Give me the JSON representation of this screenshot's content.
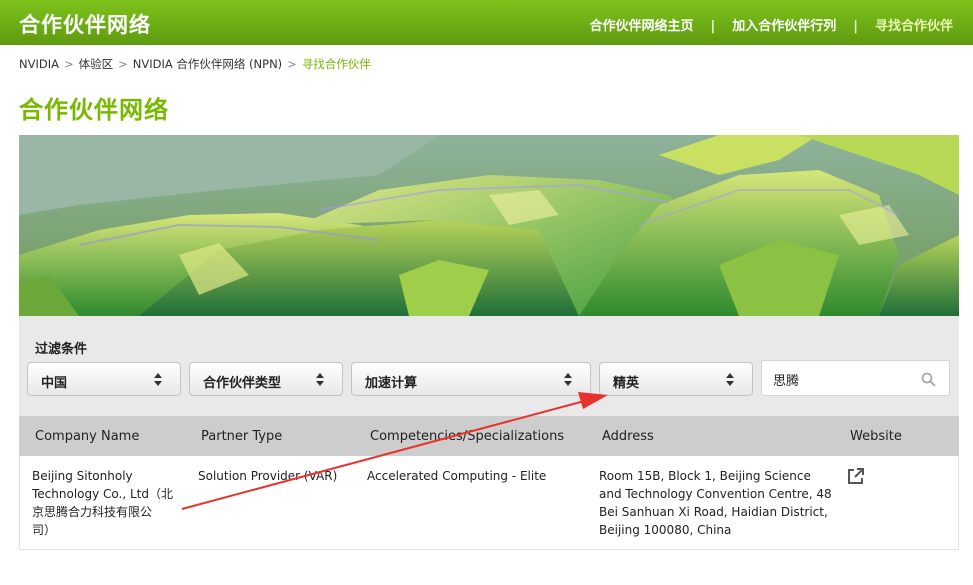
{
  "header": {
    "brand": "合作伙伴网络",
    "nav": [
      {
        "label": "合作伙伴网络主页"
      },
      {
        "label": "加入合作伙伴行列"
      },
      {
        "label": "寻找合作伙伴"
      }
    ],
    "separator": "|"
  },
  "breadcrumb": {
    "items": [
      "NVIDIA",
      "体验区",
      "NVIDIA 合作伙伴网络 (NPN)",
      "寻找合作伙伴"
    ],
    "separator": ">"
  },
  "page_title": "合作伙伴网络",
  "filters": {
    "label": "过滤条件",
    "selects": [
      {
        "value": "中国"
      },
      {
        "value": "合作伙伴类型"
      },
      {
        "value": "加速计算"
      },
      {
        "value": "精英"
      }
    ],
    "search": {
      "value": "思腾"
    }
  },
  "table": {
    "headers": [
      "Company Name",
      "Partner Type",
      "Competencies/Specializations",
      "Address",
      "Website"
    ],
    "rows": [
      {
        "company_lines": [
          "Beijing Sitonholy",
          "Technology Co., Ltd（北",
          "京思腾合力科技有限公",
          "司）"
        ],
        "partner_type": "Solution Provider (VAR)",
        "competency": "Accelerated Computing - Elite",
        "address_lines": [
          "Room 15B, Block 1, Beijing Science",
          "and Technology Convention Centre, 48",
          "Bei Sanhuan Xi Road, Haidian District,",
          "Beijing 100080, China"
        ],
        "website_icon": "external-link-icon"
      }
    ]
  },
  "colors": {
    "brand_green": "#76b900",
    "annotation_arrow": "#e8322d"
  },
  "icons": [
    "caret-updown-icon",
    "search-icon",
    "external-link-icon"
  ]
}
